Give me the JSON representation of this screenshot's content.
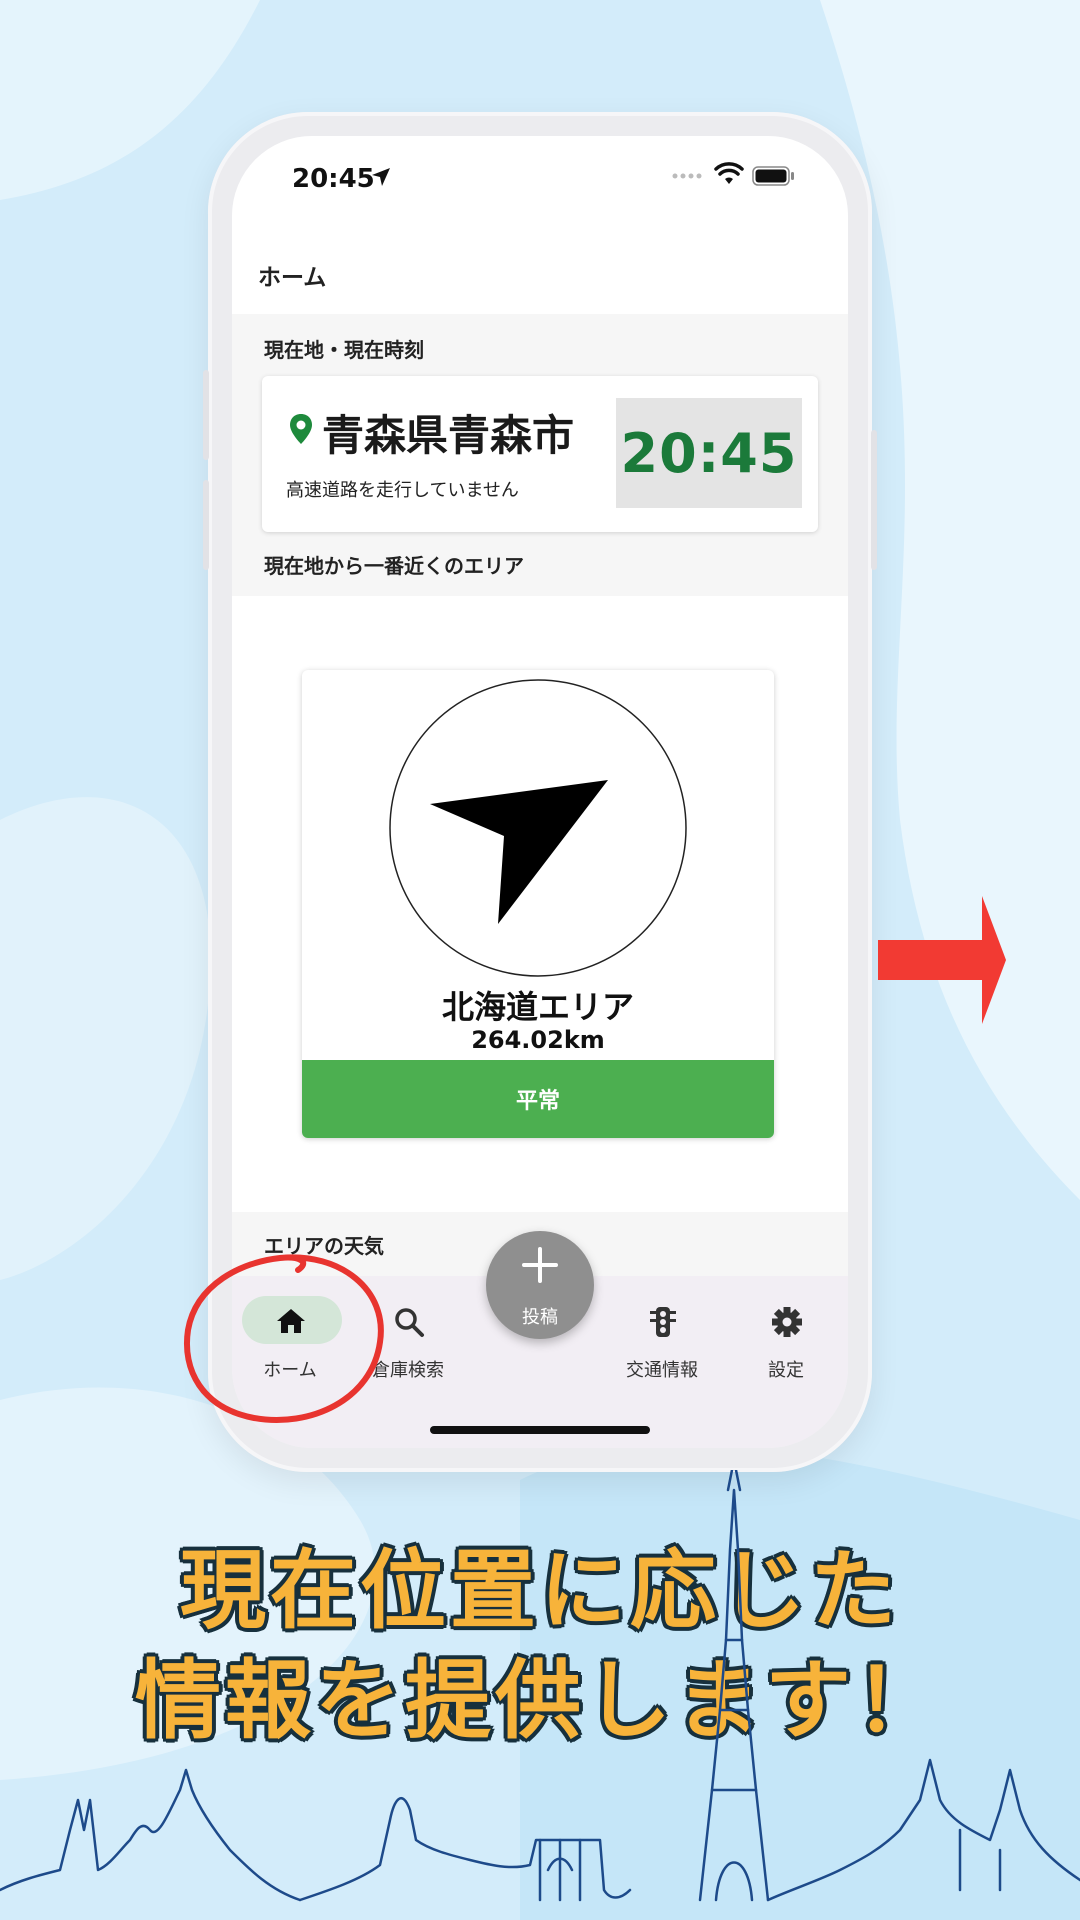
{
  "colors": {
    "background": "#d6eefb",
    "accent_green": "#4caf50",
    "time_green": "#1b7a3a",
    "annotation_red": "#e8342f",
    "headline_orange": "#f7b33a"
  },
  "status_bar": {
    "time": "20:45"
  },
  "header": {
    "title": "ホーム"
  },
  "current": {
    "section_label": "現在地・現在時刻",
    "location": "青森県青森市",
    "highway_status": "高速道路を走行していません",
    "time": "20:45"
  },
  "nearest": {
    "section_label": "現在地から一番近くのエリア",
    "area_name": "北海道エリア",
    "distance": "264.02km",
    "status": "平常"
  },
  "weather": {
    "section_label": "エリアの天気"
  },
  "fab": {
    "label": "投稿",
    "icon": "plus-icon"
  },
  "nav": {
    "items": [
      {
        "label": "ホーム",
        "icon": "home-icon",
        "active": true
      },
      {
        "label": "倉庫検索",
        "icon": "search-icon"
      },
      {
        "label": "交通情報",
        "icon": "traffic-light-icon"
      },
      {
        "label": "設定",
        "icon": "gear-icon"
      }
    ]
  },
  "promo": {
    "line1": "現在位置に応じた",
    "line2": "情報を提供します！"
  }
}
